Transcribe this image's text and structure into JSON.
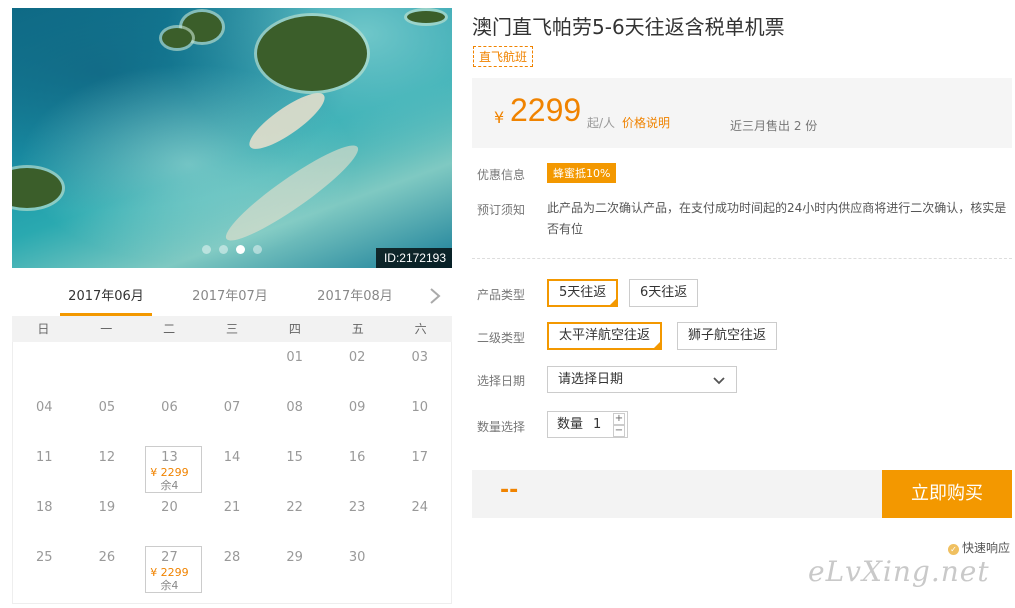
{
  "photo": {
    "id_badge": "ID:2172193",
    "dots": 4,
    "active_dot": 3
  },
  "calendar": {
    "months": [
      "2017年06月",
      "2017年07月",
      "2017年08月"
    ],
    "active_month": 0,
    "weekdays": [
      "日",
      "一",
      "二",
      "三",
      "四",
      "五",
      "六"
    ],
    "rows": [
      [
        {
          "d": ""
        },
        {
          "d": ""
        },
        {
          "d": ""
        },
        {
          "d": ""
        },
        {
          "d": "01"
        },
        {
          "d": "02"
        },
        {
          "d": "03"
        }
      ],
      [
        {
          "d": "04"
        },
        {
          "d": "05"
        },
        {
          "d": "06"
        },
        {
          "d": "07"
        },
        {
          "d": "08"
        },
        {
          "d": "09"
        },
        {
          "d": "10"
        }
      ],
      [
        {
          "d": "11"
        },
        {
          "d": "12"
        },
        {
          "d": "13",
          "price": "¥ 2299",
          "left": "余4"
        },
        {
          "d": "14"
        },
        {
          "d": "15"
        },
        {
          "d": "16"
        },
        {
          "d": "17"
        }
      ],
      [
        {
          "d": "18"
        },
        {
          "d": "19"
        },
        {
          "d": "20"
        },
        {
          "d": "21"
        },
        {
          "d": "22"
        },
        {
          "d": "23"
        },
        {
          "d": "24"
        }
      ],
      [
        {
          "d": "25"
        },
        {
          "d": "26"
        },
        {
          "d": "27",
          "price": "¥ 2299",
          "left": "余4"
        },
        {
          "d": "28"
        },
        {
          "d": "29"
        },
        {
          "d": "30"
        },
        {
          "d": ""
        }
      ]
    ]
  },
  "product": {
    "title": "澳门直飞帕劳5-6天往返含税单机票",
    "tag": "直飞航班",
    "price": {
      "yen": "¥",
      "value": "2299",
      "per": "起/人",
      "explain": "价格说明",
      "sold": "近三月售出 2 份"
    },
    "promo_label": "优惠信息",
    "promo": "蜂蜜抵10%",
    "notice_label": "预订须知",
    "notice": "此产品为二次确认产品，在支付成功时间起的24小时内供应商将进行二次确认，核实是否有位",
    "type_label": "产品类型",
    "types": [
      "5天往返",
      "6天往返"
    ],
    "subtype_label": "二级类型",
    "subtypes": [
      "太平洋航空往返",
      "狮子航空往返"
    ],
    "date_label": "选择日期",
    "date_placeholder": "请选择日期",
    "qty_label": "数量选择",
    "qty_prefix": "数量",
    "qty_value": "1",
    "total": "--",
    "buy_label": "立即购买",
    "fast_label": "快速响应",
    "watermark": "eLvXing.net"
  },
  "colors": {
    "accent": "#f39800",
    "text": "#333333"
  }
}
